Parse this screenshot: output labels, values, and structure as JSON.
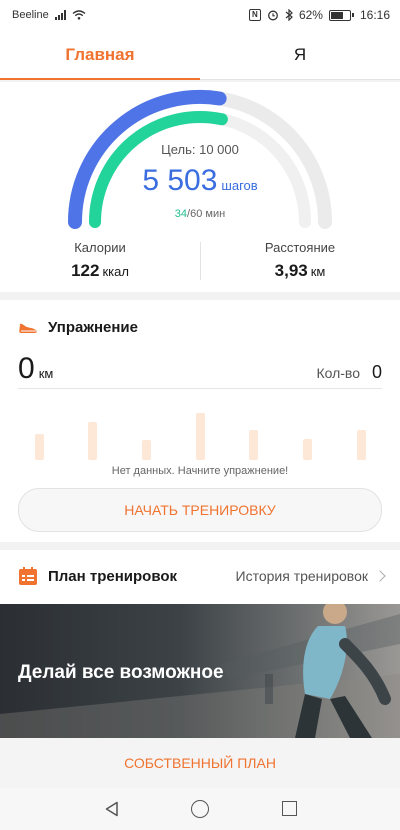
{
  "status_bar": {
    "carrier": "Beeline",
    "battery": "62%",
    "time": "16:16"
  },
  "tabs": [
    {
      "label": "Главная"
    },
    {
      "label": "Я"
    }
  ],
  "steps": {
    "goal_label": "Цель: 10 000",
    "count": "5 503",
    "unit": "шагов",
    "active_minutes": "34",
    "minutes_total": "/60 мин",
    "steps_fraction": 0.55,
    "minutes_fraction": 0.567
  },
  "stats": {
    "calories": {
      "label": "Калории",
      "value": "122",
      "unit": "ккал"
    },
    "distance": {
      "label": "Расстояние",
      "value": "3,93",
      "unit": "км"
    }
  },
  "exercise": {
    "title": "Упражнение",
    "distance_value": "0",
    "distance_unit": "км",
    "count_label": "Кол-во",
    "count_value": "0",
    "no_data": "Нет данных. Начните упражнение!",
    "start_button": "НАЧАТЬ ТРЕНИРОВКУ"
  },
  "plan": {
    "title": "План тренировок",
    "history_link": "История тренировок",
    "banner_text": "Делай все возможное",
    "own_plan_button": "СОБСТВЕННЫЙ ПЛАН"
  },
  "colors": {
    "accent": "#f07330",
    "steps_arc": "#4f74e8",
    "minutes_arc": "#22d39a"
  }
}
